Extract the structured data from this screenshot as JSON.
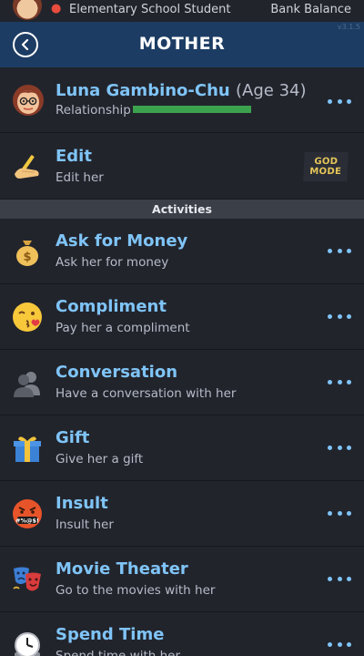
{
  "status": {
    "occupation": "Elementary School Student",
    "bank_label": "Bank Balance"
  },
  "header": {
    "title": "MOTHER",
    "version": "v3.1.5"
  },
  "person": {
    "name": "Luna Gambino-Chu",
    "age": "(Age 34)",
    "relationship_label": "Relationship",
    "relationship_level": 1.0
  },
  "edit": {
    "title": "Edit",
    "subtitle": "Edit her",
    "god_mode_line1": "GOD",
    "god_mode_line2": "MODE"
  },
  "section": {
    "activities": "Activities"
  },
  "activities": [
    {
      "title": "Ask for Money",
      "subtitle": "Ask her for money",
      "icon": "money-bag-icon"
    },
    {
      "title": "Compliment",
      "subtitle": "Pay her a compliment",
      "icon": "kiss-face-icon"
    },
    {
      "title": "Conversation",
      "subtitle": "Have a conversation with her",
      "icon": "people-icon"
    },
    {
      "title": "Gift",
      "subtitle": "Give her a gift",
      "icon": "gift-icon"
    },
    {
      "title": "Insult",
      "subtitle": "Insult her",
      "icon": "cursing-face-icon"
    },
    {
      "title": "Movie Theater",
      "subtitle": "Go to the movies with her",
      "icon": "theater-masks-icon"
    },
    {
      "title": "Spend Time",
      "subtitle": "Spend time with her",
      "icon": "clock-icon"
    }
  ],
  "colors": {
    "header_bg": "#1c3c63",
    "accent_blue": "#7fc4f7",
    "relationship_green": "#3ba24d",
    "background": "#22242c"
  }
}
